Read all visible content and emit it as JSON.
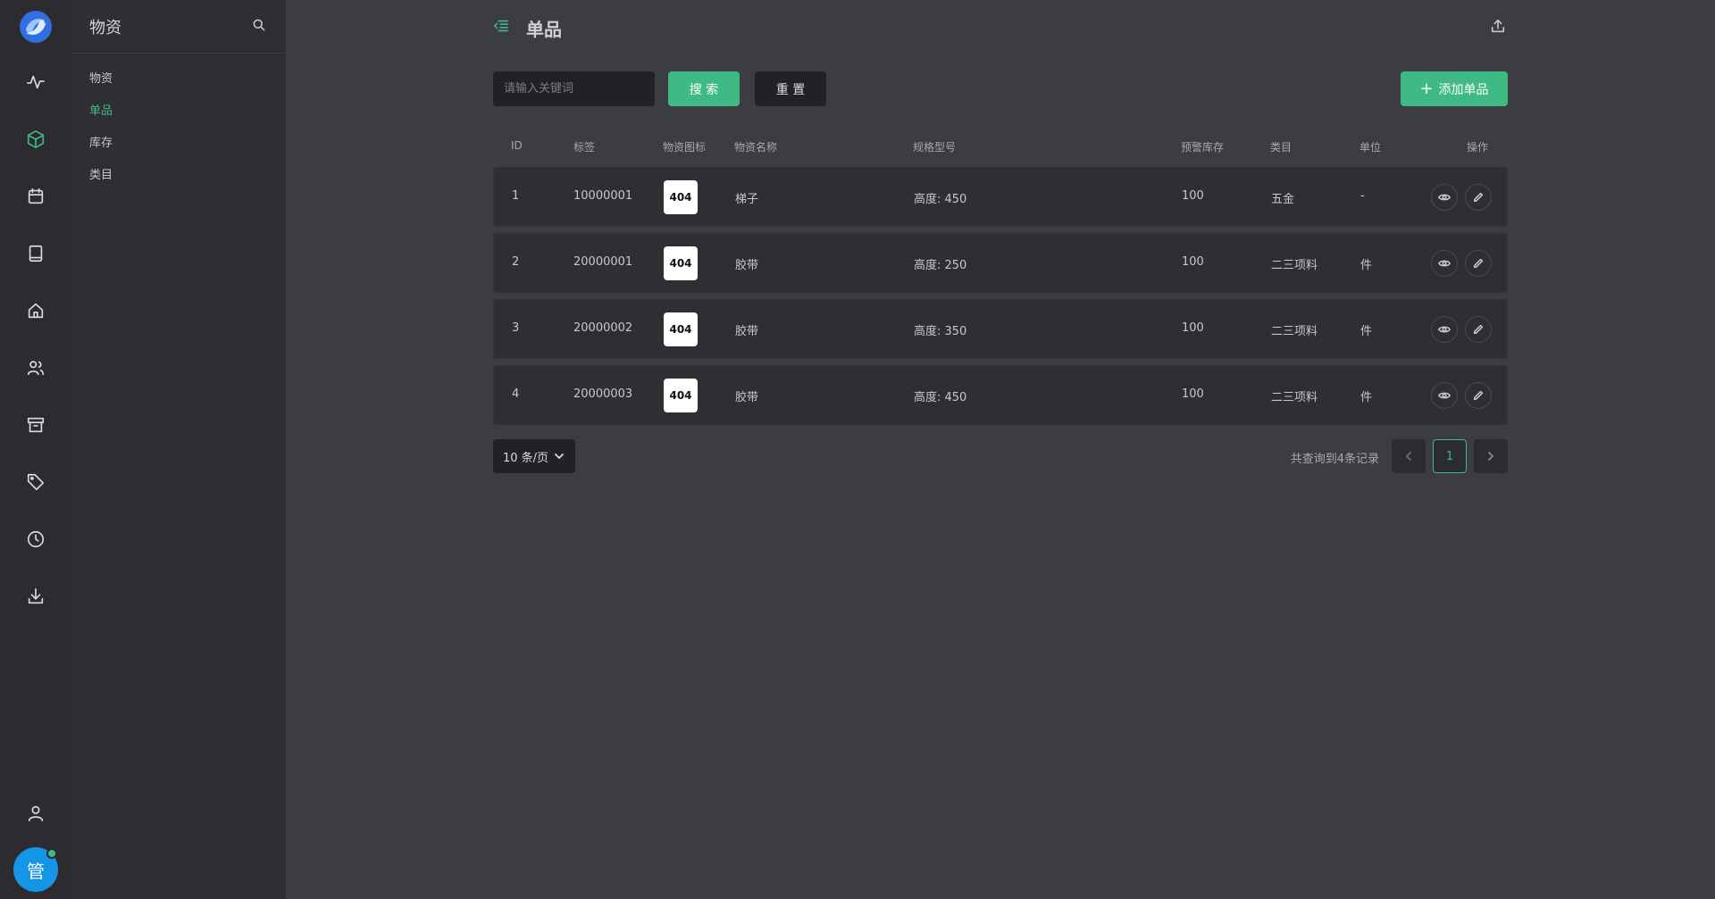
{
  "sidebar": {
    "title": "物资",
    "items": [
      {
        "label": "物资",
        "active": false
      },
      {
        "label": "单品",
        "active": true
      },
      {
        "label": "库存",
        "active": false
      },
      {
        "label": "类目",
        "active": false
      }
    ]
  },
  "rail": {
    "icons": [
      "activity-icon",
      "box-icon",
      "calendar-icon",
      "book-icon",
      "home-icon",
      "users-icon",
      "archive-icon",
      "tag-icon",
      "clock-icon",
      "download-icon"
    ],
    "active_icon": "box-icon",
    "user_icon": "user-icon",
    "avatar_text": "管",
    "avatar_color": "#1495e6",
    "status_color": "#3fba85"
  },
  "header": {
    "title": "单品"
  },
  "filter": {
    "search_placeholder": "请输入关键词",
    "search_label": "搜 索",
    "reset_label": "重 置",
    "add_label": "添加单品"
  },
  "table": {
    "columns": {
      "id": "ID",
      "tag": "标签",
      "icon": "物资图标",
      "name": "物资名称",
      "spec": "规格型号",
      "warn": "预警库存",
      "category": "类目",
      "unit": "单位",
      "ops": "操作"
    },
    "rows": [
      {
        "id": "1",
        "tag": "10000001",
        "icon": "404",
        "name": "梯子",
        "spec": "高度: 450",
        "warn": "100",
        "category": "五金",
        "unit": "-"
      },
      {
        "id": "2",
        "tag": "20000001",
        "icon": "404",
        "name": "胶带",
        "spec": "高度: 250",
        "warn": "100",
        "category": "二三项料",
        "unit": "件"
      },
      {
        "id": "3",
        "tag": "20000002",
        "icon": "404",
        "name": "胶带",
        "spec": "高度: 350",
        "warn": "100",
        "category": "二三项料",
        "unit": "件"
      },
      {
        "id": "4",
        "tag": "20000003",
        "icon": "404",
        "name": "胶带",
        "spec": "高度: 450",
        "warn": "100",
        "category": "二三项料",
        "unit": "件"
      }
    ]
  },
  "pagination": {
    "page_size": "10 条/页",
    "total_text": "共查询到4条记录",
    "current_page": "1"
  },
  "colors": {
    "accent": "#3fba85",
    "background": "#3c3c43",
    "sidebar": "#2e2e33",
    "rail": "#2b2b30"
  }
}
